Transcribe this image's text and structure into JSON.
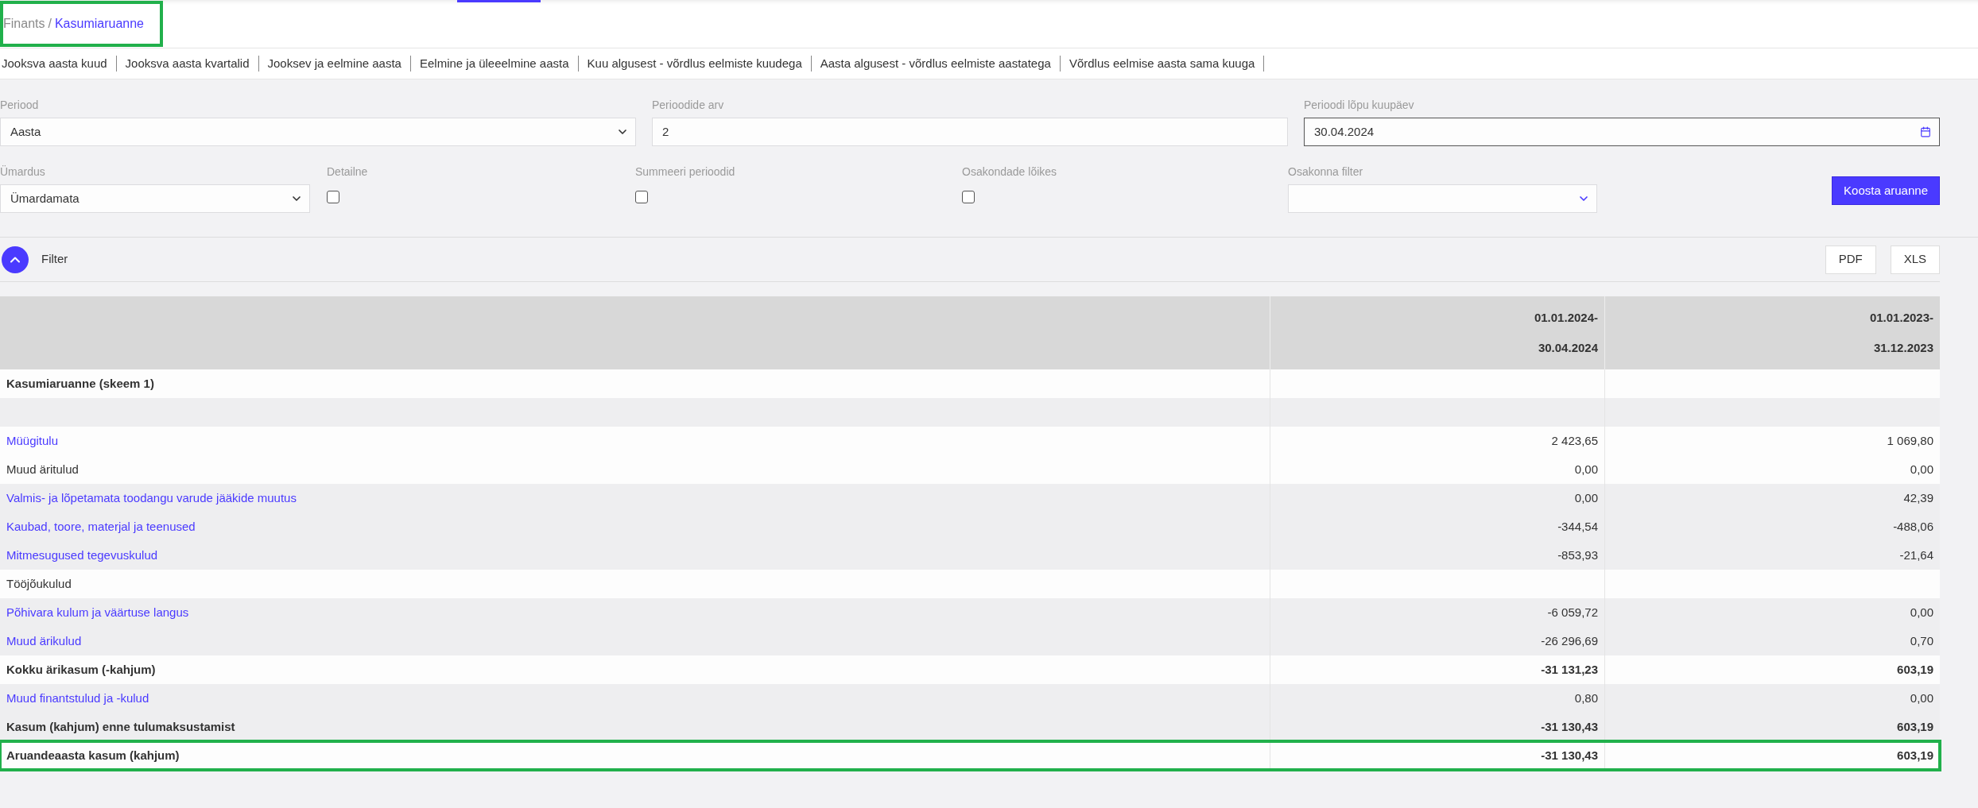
{
  "breadcrumb": {
    "parent": "Finants",
    "separator": "/",
    "current": "Kasumiaruanne",
    "highlighted": true
  },
  "report_tabs": [
    "Jooksva aasta kuud",
    "Jooksva aasta kvartalid",
    "Jooksev ja eelmine aasta",
    "Eelmine ja üleeelmine aasta",
    "Kuu algusest - võrdlus eelmiste kuudega",
    "Aasta algusest - võrdlus eelmiste aastatega",
    "Võrdlus eelmise aasta sama kuuga"
  ],
  "filters": {
    "period": {
      "label": "Periood",
      "value": "Aasta"
    },
    "period_count": {
      "label": "Perioodide arv",
      "value": "2"
    },
    "end_date": {
      "label": "Perioodi lõpu kuupäev",
      "value": "30.04.2024"
    },
    "rounding": {
      "label": "Ümardus",
      "value": "Ümardamata"
    },
    "checkboxes": [
      {
        "label": "Detailne",
        "checked": false
      },
      {
        "label": "Summeeri perioodid",
        "checked": false
      },
      {
        "label": "Osakondade lõikes",
        "checked": false
      }
    ],
    "department": {
      "label": "Osakonna filter"
    },
    "submit": "Koosta aruanne"
  },
  "filter_bar": {
    "label": "Filter",
    "expanded": true,
    "exports": [
      "PDF",
      "XLS"
    ]
  },
  "table": {
    "columns": [
      [
        "01.01.2024-",
        "30.04.2024"
      ],
      [
        "01.01.2023-",
        "31.12.2023"
      ]
    ],
    "rows": [
      {
        "kind": "heading",
        "label": "Kasumiaruanne (skeem 1)",
        "shaded": false,
        "highlighted": false
      },
      {
        "kind": "spacer",
        "shaded": true,
        "highlighted": false
      },
      {
        "kind": "link",
        "label": "Müügitulu",
        "values": [
          "2 423,65",
          "1 069,80"
        ],
        "shaded": false,
        "highlighted": false
      },
      {
        "kind": "plain",
        "label": "Muud äritulud",
        "values": [
          "0,00",
          "0,00"
        ],
        "shaded": false,
        "highlighted": false
      },
      {
        "kind": "link",
        "label": "Valmis- ja lõpetamata toodangu varude jääkide muutus",
        "values": [
          "0,00",
          "42,39"
        ],
        "shaded": true,
        "highlighted": false
      },
      {
        "kind": "link",
        "label": "Kaubad, toore, materjal ja teenused",
        "values": [
          "-344,54",
          "-488,06"
        ],
        "shaded": true,
        "highlighted": false
      },
      {
        "kind": "link",
        "label": "Mitmesugused tegevuskulud",
        "values": [
          "-853,93",
          "-21,64"
        ],
        "shaded": true,
        "highlighted": false
      },
      {
        "kind": "plain",
        "label": "Tööjõukulud",
        "shaded": false,
        "highlighted": false
      },
      {
        "kind": "link",
        "label": "Põhivara kulum ja väärtuse langus",
        "values": [
          "-6 059,72",
          "0,00"
        ],
        "shaded": true,
        "highlighted": false
      },
      {
        "kind": "link",
        "label": "Muud ärikulud",
        "values": [
          "-26 296,69",
          "0,70"
        ],
        "shaded": true,
        "highlighted": false
      },
      {
        "kind": "heading",
        "label": "Kokku ärikasum (-kahjum)",
        "values": [
          "-31 131,23",
          "603,19"
        ],
        "shaded": false,
        "highlighted": false
      },
      {
        "kind": "link",
        "label": "Muud finantstulud ja -kulud",
        "values": [
          "0,80",
          "0,00"
        ],
        "shaded": true,
        "highlighted": false
      },
      {
        "kind": "heading",
        "label": "Kasum (kahjum) enne tulumaksustamist",
        "values": [
          "-31 130,43",
          "603,19"
        ],
        "shaded": true,
        "highlighted": false
      },
      {
        "kind": "heading",
        "label": "Aruandeaasta kasum (kahjum)",
        "values": [
          "-31 130,43",
          "603,19"
        ],
        "shaded": false,
        "highlighted": true
      }
    ]
  }
}
